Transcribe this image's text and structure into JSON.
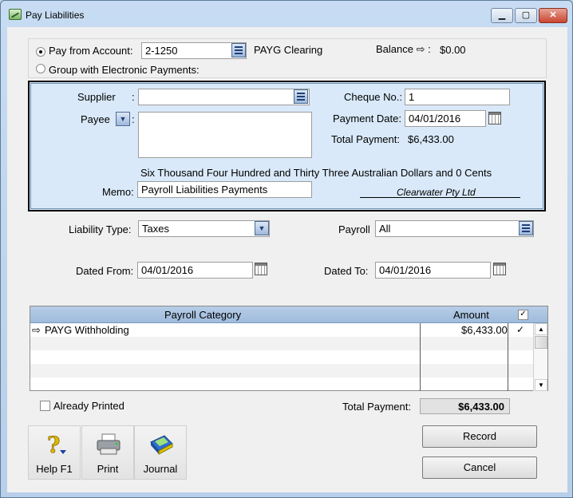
{
  "window": {
    "title": "Pay Liabilities",
    "buttons": {
      "minimize": "▁",
      "maximize": "▢",
      "close": "✕"
    }
  },
  "pay_from": {
    "radio_label": "Pay from Account:",
    "account_code": "2-1250",
    "account_name": "PAYG Clearing",
    "balance_label": "Balance ⇨ :",
    "balance_value": "$0.00",
    "group_radio_label": "Group with Electronic Payments:"
  },
  "payment": {
    "supplier_label": "Supplier",
    "supplier_colon": ":",
    "supplier_value": "",
    "payee_label": "Payee",
    "payee_value": "",
    "cheque_label": "Cheque No.:",
    "cheque_value": "1",
    "payment_date_label": "Payment Date:",
    "payment_date_value": "04/01/2016",
    "total_payment_label": "Total Payment:",
    "total_payment_value": "$6,433.00",
    "amount_words": "Six Thousand Four Hundred and Thirty Three Australian Dollars and 0 Cents",
    "memo_label": "Memo:",
    "memo_value": "Payroll Liabilities Payments",
    "signature": "Clearwater Pty Ltd"
  },
  "filters": {
    "liability_type_label": "Liability Type:",
    "liability_type_value": "Taxes",
    "payroll_label": "Payroll",
    "payroll_value": "All",
    "dated_from_label": "Dated From:",
    "dated_from_value": "04/01/2016",
    "dated_to_label": "Dated To:",
    "dated_to_value": "04/01/2016"
  },
  "grid": {
    "columns": [
      "Payroll Category",
      "Amount"
    ],
    "rows": [
      {
        "arrow": "⇨",
        "category": "PAYG Withholding",
        "amount": "$6,433.00",
        "check": "✓"
      }
    ]
  },
  "footer": {
    "already_printed_label": "Already Printed",
    "total_payment_label": "Total Payment:",
    "total_payment_value": "$6,433.00",
    "record_label": "Record",
    "cancel_label": "Cancel"
  },
  "toolbar": {
    "help_label": "Help F1",
    "print_label": "Print",
    "journal_label": "Journal"
  }
}
